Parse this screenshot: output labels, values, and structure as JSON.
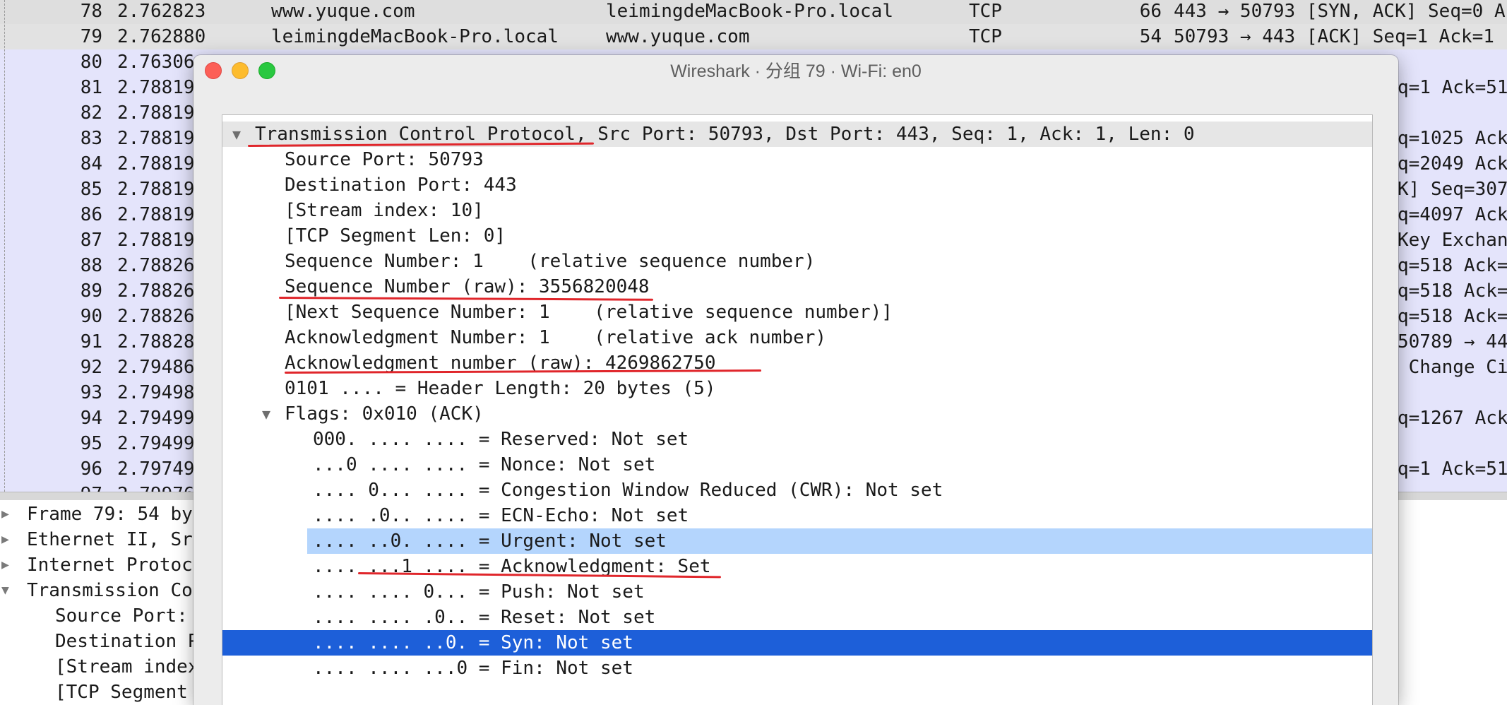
{
  "packet_list": {
    "rows": [
      {
        "no": "78",
        "time": "2.762823",
        "source": "www.yuque.com",
        "destination": "leimingdeMacBook-Pro.local",
        "protocol": "TCP",
        "length": "66",
        "info": "443 → 50793 [SYN, ACK] Seq=0 A",
        "bg": "#dedede"
      },
      {
        "no": "79",
        "time": "2.762880",
        "source": "leimingdeMacBook-Pro.local",
        "destination": "www.yuque.com",
        "protocol": "TCP",
        "length": "54",
        "info": "50793 → 443 [ACK] Seq=1 Ack=1",
        "bg": "#e2e2e2"
      },
      {
        "no": "80",
        "time": "2.76306",
        "info": "",
        "bg": "#e4e4fb"
      },
      {
        "no": "81",
        "time": "2.78819",
        "info": "q=1 Ack=51",
        "bg": "#e4e4fb"
      },
      {
        "no": "82",
        "time": "2.78819",
        "info": "",
        "bg": "#e4e4fb"
      },
      {
        "no": "83",
        "time": "2.78819",
        "info": "q=1025 Ack",
        "bg": "#e4e4fb"
      },
      {
        "no": "84",
        "time": "2.78819",
        "info": "q=2049 Ack",
        "bg": "#e4e4fb"
      },
      {
        "no": "85",
        "time": "2.78819",
        "info": "K] Seq=307",
        "bg": "#e4e4fb"
      },
      {
        "no": "86",
        "time": "2.78819",
        "info": "q=4097 Ack",
        "bg": "#e4e4fb"
      },
      {
        "no": "87",
        "time": "2.78819",
        "info": "Key Exchan",
        "bg": "#e4e4fb"
      },
      {
        "no": "88",
        "time": "2.78826",
        "info": "q=518 Ack=",
        "bg": "#e4e4fb"
      },
      {
        "no": "89",
        "time": "2.78826",
        "info": "q=518 Ack=",
        "bg": "#e4e4fb"
      },
      {
        "no": "90",
        "time": "2.78826",
        "info": "q=518 Ack=",
        "bg": "#e4e4fb"
      },
      {
        "no": "91",
        "time": "2.78828",
        "info": "50789 → 44",
        "bg": "#e4e4fb"
      },
      {
        "no": "92",
        "time": "2.79486",
        "info": " Change Ci",
        "bg": "#e4e4fb"
      },
      {
        "no": "93",
        "time": "2.79498",
        "info": "",
        "bg": "#e4e4fb"
      },
      {
        "no": "94",
        "time": "2.79499",
        "info": "q=1267 Ack",
        "bg": "#e4e4fb"
      },
      {
        "no": "95",
        "time": "2.79499",
        "info": "",
        "bg": "#e4e4fb"
      },
      {
        "no": "96",
        "time": "2.79749",
        "info": "q=1 Ack=51",
        "bg": "#e4e4fb"
      },
      {
        "no": "97",
        "time": "2.79976",
        "info": "",
        "bg": "#e4e4fb"
      }
    ]
  },
  "details": {
    "rows": [
      {
        "text": "Frame 79: 54 by",
        "expanded": false,
        "indent": 0
      },
      {
        "text": "Ethernet II, Sr",
        "expanded": false,
        "indent": 0
      },
      {
        "text": "Internet Protoc",
        "expanded": false,
        "indent": 0
      },
      {
        "text": "Transmission Co",
        "expanded": true,
        "indent": 0
      },
      {
        "text": "Source Port:",
        "indent": 1
      },
      {
        "text": "Destination P",
        "indent": 1
      },
      {
        "text": "[Stream index",
        "indent": 1
      },
      {
        "text": "[TCP Segment ",
        "indent": 1
      }
    ]
  },
  "window": {
    "title": "Wireshark · 分组 79 · Wi-Fi: en0",
    "tree": {
      "header": "Transmission Control Protocol, Src Port: 50793, Dst Port: 443, Seq: 1, Ack: 1, Len: 0",
      "fields": [
        "Source Port: 50793",
        "Destination Port: 443",
        "[Stream index: 10]",
        "[TCP Segment Len: 0]",
        "Sequence Number: 1    (relative sequence number)",
        "Sequence Number (raw): 3556820048",
        "[Next Sequence Number: 1    (relative sequence number)]",
        "Acknowledgment Number: 1    (relative ack number)",
        "Acknowledgment number (raw): 4269862750",
        "0101 .... = Header Length: 20 bytes (5)"
      ],
      "flags_header": "Flags: 0x010 (ACK)",
      "flags": [
        "000. .... .... = Reserved: Not set",
        "...0 .... .... = Nonce: Not set",
        ".... 0... .... = Congestion Window Reduced (CWR): Not set",
        ".... .0.. .... = ECN-Echo: Not set",
        ".... ..0. .... = Urgent: Not set",
        ".... ...1 .... = Acknowledgment: Set",
        ".... .... 0... = Push: Not set",
        ".... .... .0.. = Reset: Not set",
        ".... .... ..0. = Syn: Not set",
        ".... .... ...0 = Fin: Not set"
      ]
    }
  },
  "colors": {
    "selected_row": "#1d5fd9",
    "hover_row": "#b4d5fd",
    "annotation": "#e0262b",
    "tls_rows": "#e4e4fb"
  }
}
